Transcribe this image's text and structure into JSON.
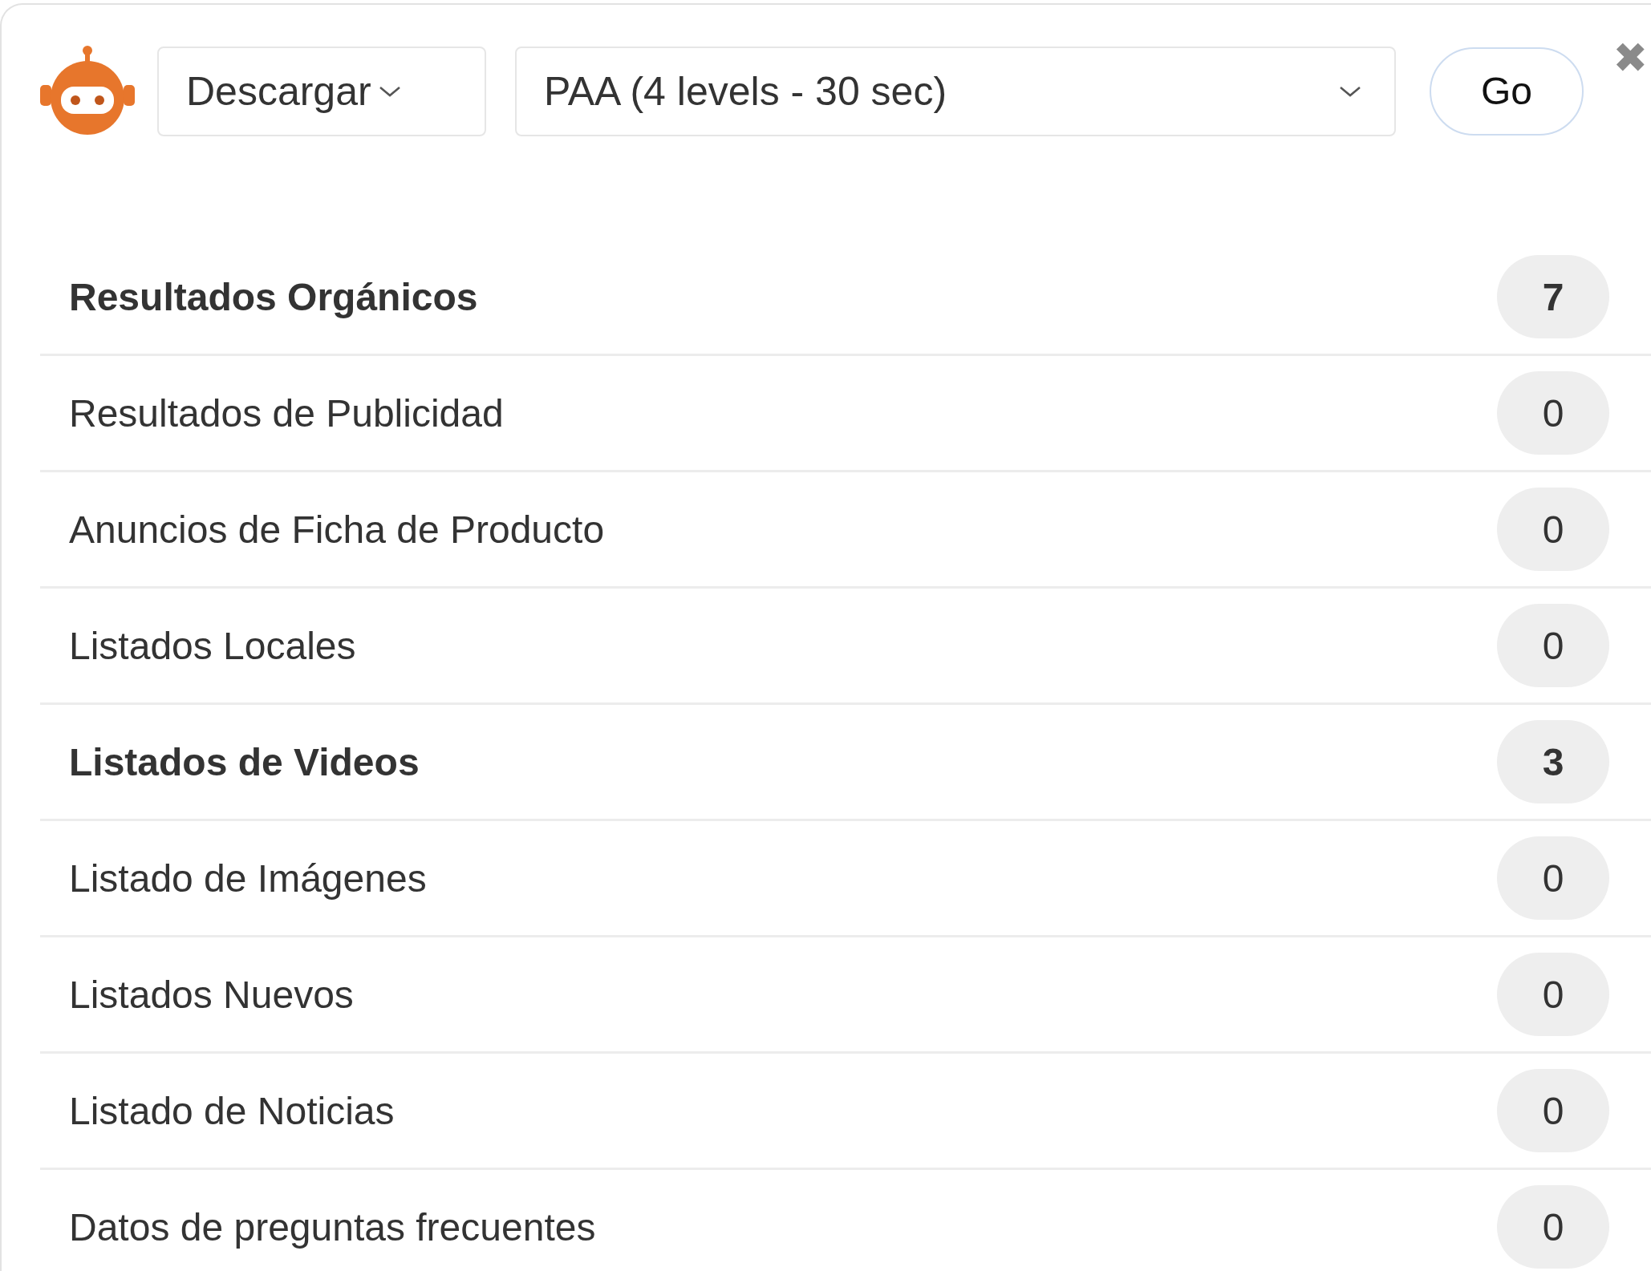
{
  "toolbar": {
    "action_select": {
      "value": "Descargar"
    },
    "mode_select": {
      "value": "PAA (4 levels - 30 sec)"
    },
    "go_button": {
      "label": "Go"
    },
    "close_button": {
      "label": "✖"
    }
  },
  "results": [
    {
      "label": "Resultados Orgánicos",
      "count": "7",
      "bold": true
    },
    {
      "label": "Resultados de Publicidad",
      "count": "0",
      "bold": false
    },
    {
      "label": "Anuncios de Ficha de Producto",
      "count": "0",
      "bold": false
    },
    {
      "label": "Listados Locales",
      "count": "0",
      "bold": false
    },
    {
      "label": "Listados de Videos",
      "count": "3",
      "bold": true
    },
    {
      "label": "Listado de Imágenes",
      "count": "0",
      "bold": false
    },
    {
      "label": "Listados Nuevos",
      "count": "0",
      "bold": false
    },
    {
      "label": "Listado de Noticias",
      "count": "0",
      "bold": false
    },
    {
      "label": "Datos de preguntas frecuentes",
      "count": "0",
      "bold": false
    }
  ]
}
